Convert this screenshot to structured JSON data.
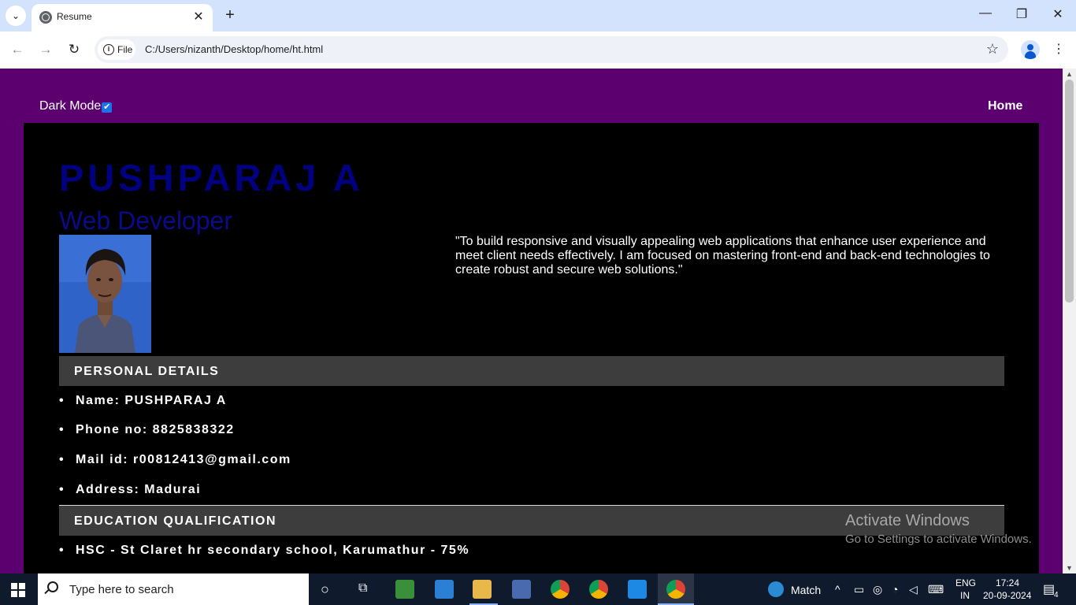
{
  "browser": {
    "tab_title": "Resume",
    "new_tab": "+",
    "close_tab": "✕",
    "site_chip": "File",
    "url": "C:/Users/nizanth/Desktop/home/ht.html",
    "window_min": "—",
    "window_max": "❐",
    "window_close": "✕"
  },
  "page": {
    "dark_mode_label": "Dark Mode",
    "dark_mode_checked": true,
    "home_link": "Home",
    "name": "PUSHPARAJ A",
    "job_title": "Web Developer",
    "objective": "\"To build responsive and visually appealing web applications that enhance user experience and meet client needs effectively. I am focused on mastering front-end and back-end technologies to create robust and secure web solutions.\"",
    "personal_section": {
      "title": "PERSONAL DETAILS",
      "items": [
        "Name: PUSHPARAJ A",
        "Phone no: 8825838322",
        "Mail id: r00812413@gmail.com",
        "Address: Madurai"
      ]
    },
    "education_section": {
      "title": "EDUCATION QUALIFICATION",
      "items": [
        "HSC - St Claret hr secondary school, Karumathur - 75%"
      ]
    },
    "watermark": {
      "line1": "Activate Windows",
      "line2": "Go to Settings to activate Windows."
    }
  },
  "taskbar": {
    "search_placeholder": "Type here to search",
    "weather_label": "Match",
    "language_top": "ENG",
    "language_bottom": "IN",
    "time": "17:24",
    "date": "20-09-2024",
    "notification_count": "4"
  },
  "colors": {
    "page_background": "#5c0070",
    "resume_background": "#000000",
    "name_color": "#000080",
    "section_bar": "#3d3d3d"
  }
}
